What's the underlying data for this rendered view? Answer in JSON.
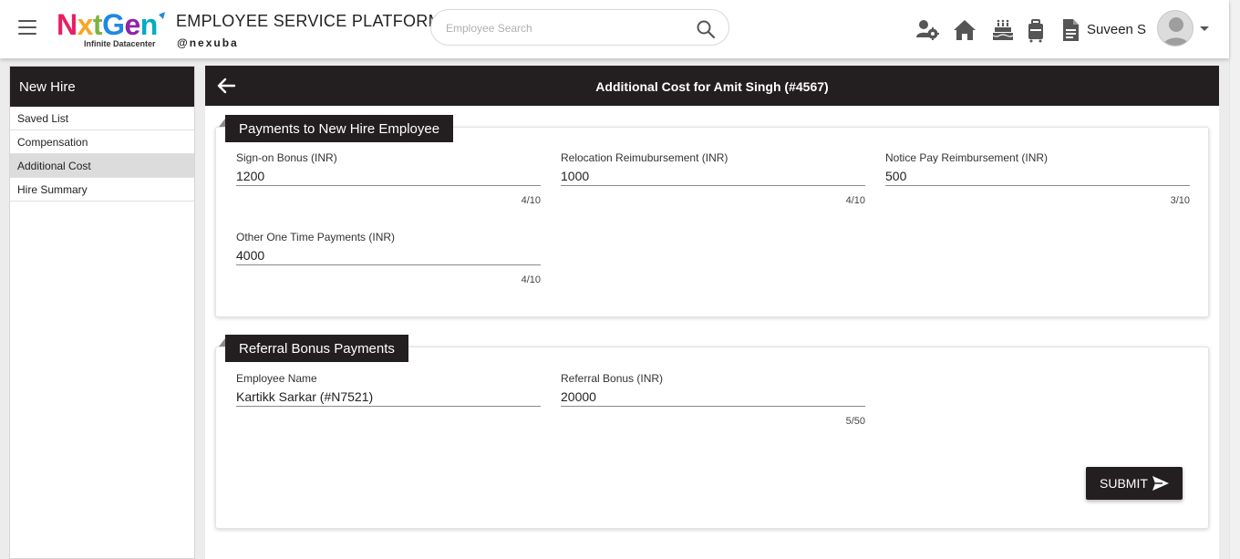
{
  "header": {
    "logo": {
      "word_parts": [
        "N",
        "x",
        "t",
        "G",
        "e",
        "n"
      ],
      "tagline": "Infinite Datacenter"
    },
    "title": "EMPLOYEE SERVICE PLATFORM",
    "handle": "@nexuba",
    "search": {
      "placeholder": "Employee Search",
      "value": ""
    },
    "icons": [
      "team-settings-icon",
      "home-icon",
      "birthday-cake-icon",
      "luggage-icon",
      "document-icon"
    ],
    "user_name": "Suveen S"
  },
  "sidebar": {
    "title": "New Hire",
    "items": [
      {
        "label": "Saved List",
        "active": false
      },
      {
        "label": "Compensation",
        "active": false
      },
      {
        "label": "Additional Cost",
        "active": true
      },
      {
        "label": "Hire Summary",
        "active": false
      }
    ]
  },
  "main": {
    "title": "Additional Cost for Amit Singh (#4567)",
    "sections": [
      {
        "title": "Payments to New Hire Employee",
        "fields": [
          {
            "label": "Sign-on Bonus (INR)",
            "value": "1200",
            "count": "4/10"
          },
          {
            "label": "Relocation Reimubursement (INR)",
            "value": "1000",
            "count": "4/10"
          },
          {
            "label": "Notice Pay Reimbursement (INR)",
            "value": "500",
            "count": "3/10"
          },
          {
            "label": "Other One Time Payments (INR)",
            "value": "4000",
            "count": "4/10"
          }
        ]
      },
      {
        "title": "Referral Bonus Payments",
        "fields": [
          {
            "label": "Employee Name",
            "value": "Kartikk Sarkar (#N7521)",
            "count": ""
          },
          {
            "label": "Referral Bonus (INR)",
            "value": "20000",
            "count": "5/50"
          }
        ]
      }
    ],
    "submit_label": "SUBMIT"
  },
  "colors": {
    "dark": "#231f20",
    "active_item": "#dcdcdc"
  }
}
